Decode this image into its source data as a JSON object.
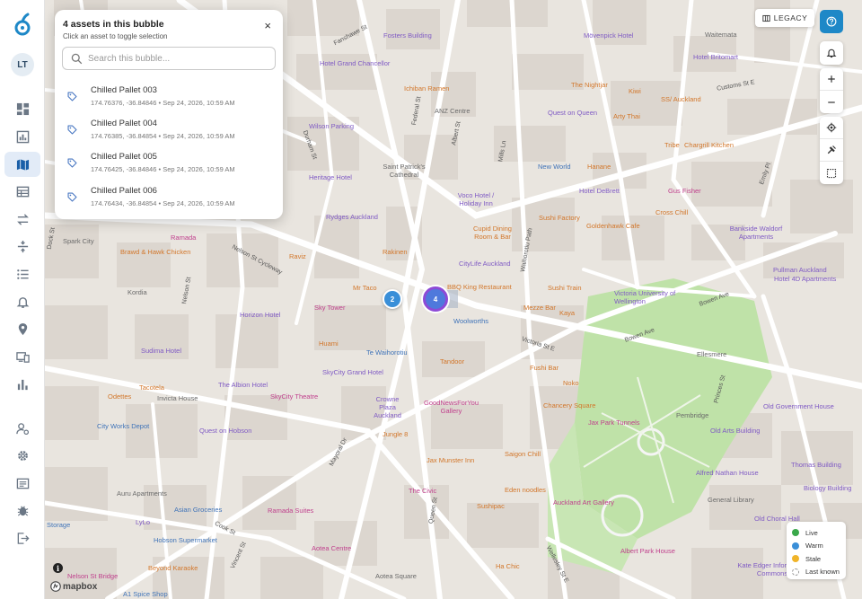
{
  "sidebar": {
    "avatar_initials": "LT",
    "items": [
      {
        "icon": "dashboard-icon"
      },
      {
        "icon": "reports-icon"
      },
      {
        "icon": "map-icon",
        "active": true
      },
      {
        "icon": "table-icon"
      },
      {
        "icon": "transfer-icon"
      },
      {
        "icon": "split-icon"
      },
      {
        "icon": "list-icon"
      },
      {
        "icon": "bell-icon"
      },
      {
        "icon": "location-pin-icon"
      },
      {
        "icon": "devices-icon"
      },
      {
        "icon": "bar-chart-icon"
      },
      {
        "icon": "user-settings-icon"
      },
      {
        "icon": "gear-icon"
      },
      {
        "icon": "id-card-icon"
      },
      {
        "icon": "bug-icon"
      },
      {
        "icon": "logout-icon"
      }
    ]
  },
  "popup": {
    "title": "4 assets in this bubble",
    "subtitle": "Click an asset to toggle selection",
    "close": "×",
    "search_placeholder": "Search this bubble...",
    "assets": [
      {
        "name": "Chilled Pallet 003",
        "meta": "174.76376, -36.84846 • Sep 24, 2026, 10:59 AM"
      },
      {
        "name": "Chilled Pallet 004",
        "meta": "174.76385, -36.84854 • Sep 24, 2026, 10:59 AM"
      },
      {
        "name": "Chilled Pallet 005",
        "meta": "174.76425, -36.84846 • Sep 24, 2026, 10:59 AM"
      },
      {
        "name": "Chilled Pallet 006",
        "meta": "174.76434, -36.84854 • Sep 24, 2026, 10:59 AM"
      }
    ]
  },
  "controls": {
    "legacy_label": "LEGACY"
  },
  "legend": {
    "items": [
      {
        "label": "Live",
        "color": "#3aa84a"
      },
      {
        "label": "Warm",
        "color": "#3a8fd8"
      },
      {
        "label": "Stale",
        "color": "#f0b429"
      },
      {
        "label": "Last known",
        "color": "#cccccc"
      }
    ]
  },
  "clusters": [
    {
      "count": "2",
      "color": "#3a8fd8"
    },
    {
      "count": "4",
      "color": "#5b6fe0"
    }
  ],
  "attribution": "mapbox",
  "map_labels": {
    "fosters": "Fosters Building",
    "movenpick": "Mövenpick Hotel",
    "waitemata": "Waitemata",
    "britomart": "Hotel Britomart",
    "grand_chancellor": "Hotel Grand Chancellor",
    "fanshawe": "Fanshawe St",
    "customs": "Customs St E",
    "ichiban": "Ichiban Ramen",
    "nightjar": "The Nightjar",
    "kiwi": "Kiwi",
    "ss_auckland": "SS/ Auckland",
    "anz": "ANZ Centre",
    "quest_queen": "Quest on Queen",
    "arty_thai": "Arty Thai",
    "wilson": "Wilson Parking",
    "durham": "Durham St",
    "tribe": "Tribe",
    "chargrill": "Chargrill Kitchen",
    "new_world": "New World",
    "hanane": "Hanane",
    "st_patricks": "Saint Patrick's Cathedral",
    "heritage": "Heritage Hotel",
    "debrett": "Hotel DeBrett",
    "gus_fisher": "Gus Fisher",
    "emily": "Emily Pl",
    "voco": "Voco Hotel / Holiday Inn",
    "federal": "Federal St",
    "albert": "Albert St",
    "mills": "Mills Ln",
    "rydges": "Rydges Auckland",
    "sushi_factory": "Sushi Factory",
    "cross_chill": "Cross Chill",
    "goldenhawk": "Goldenhawk Cafe",
    "bankside": "Bankside Waldorf Apartments",
    "spark": "Spark City",
    "ramada": "Ramada",
    "cupid": "Cupid Dining Room & Bar",
    "brawd": "Brawd & Hawk Chicken",
    "sky_cycleway": "Nelson St Cycleway",
    "raviz": "Raviz",
    "rakinen": "Rakinen",
    "citylife": "CityLife Auckland",
    "waihorotiu": "Waihorotiu Path",
    "pullman": "Pullman Auckland",
    "hotel_grand": "Hotel 4D Apartments",
    "bbq_king": "BBQ King Restaurant",
    "sushi_train": "Sushi Train",
    "mr_taco": "Mr Taco",
    "kordia": "Kordia",
    "victoria_uni": "Victoria University of Wellington",
    "bowen": "Bowen Ave",
    "sky_tower": "Sky Tower",
    "horizon": "Horizon Hotel",
    "woolworths": "Woolworths",
    "mezze": "Mezze Bar",
    "kaya": "Kaya",
    "nelson": "Nelson St",
    "victoria_st": "Victoria St E",
    "bowen2": "Bowen Ave",
    "ellesmere": "Ellesmere",
    "sudima": "Sudima Hotel",
    "huami": "Huami",
    "waihorotiu_te": "Te Waihorotiu",
    "tandoor": "Tandoor",
    "yoshi": "Fushi Bar",
    "albion": "The Albion Hotel",
    "skycity_grand": "SkyCity Grand Hotel",
    "noko": "Noko",
    "odettes": "Odettes",
    "tacotela": "Tacotela",
    "invicta": "Invicta House",
    "skycity_theatre": "SkyCity Theatre",
    "crowne": "Crowne Plaza Auckland",
    "goodnews": "GoodNewsForYou Gallery",
    "chancery": "Chancery Square",
    "old_gov": "Old Government House",
    "jax_tunnels": "Jax Park Tunnels",
    "pembridge": "Pembridge",
    "old_arts": "Old Arts Building",
    "city_works": "City Works Depot",
    "quest_hobson": "Quest on Hobson",
    "jungle": "Jungle 8",
    "princes": "Princes St",
    "thomas": "Thomas Building",
    "jax_munster": "Jax Munster Inn",
    "saigon": "Saigon Chill",
    "alfred": "Alfred Nathan House",
    "auru": "Auru Apartments",
    "mayoral": "Mayoral Dr",
    "civic": "The Civic",
    "eden": "Eden noodles",
    "general_library": "General Library",
    "biology": "Biology Building",
    "asian_groceries": "Asian Groceries",
    "ramada_suites": "Ramada Suites",
    "sushipac": "Sushipac",
    "auckland_art": "Auckland Art Gallery",
    "lylo": "LyLo",
    "storage": "Storage",
    "cook": "Cook St",
    "hobson_market": "Hobson Supermarket",
    "aotea": "Aotea Centre",
    "old_choral": "Old Choral Hall",
    "albert_park": "Albert Park House",
    "kate_edger": "Kate Edger Information Commons",
    "nelson_bridge": "Nelson St Bridge",
    "beyond_karaoke": "Beyond Karaoke",
    "aotea_square": "Aotea Square",
    "ha_chic": "Ha Chic",
    "wellesley": "Wellesley St E",
    "queen": "Queen St",
    "vincent": "Vincent St",
    "dock": "Dock St",
    "a1_spice": "A1 Spice Shop"
  }
}
